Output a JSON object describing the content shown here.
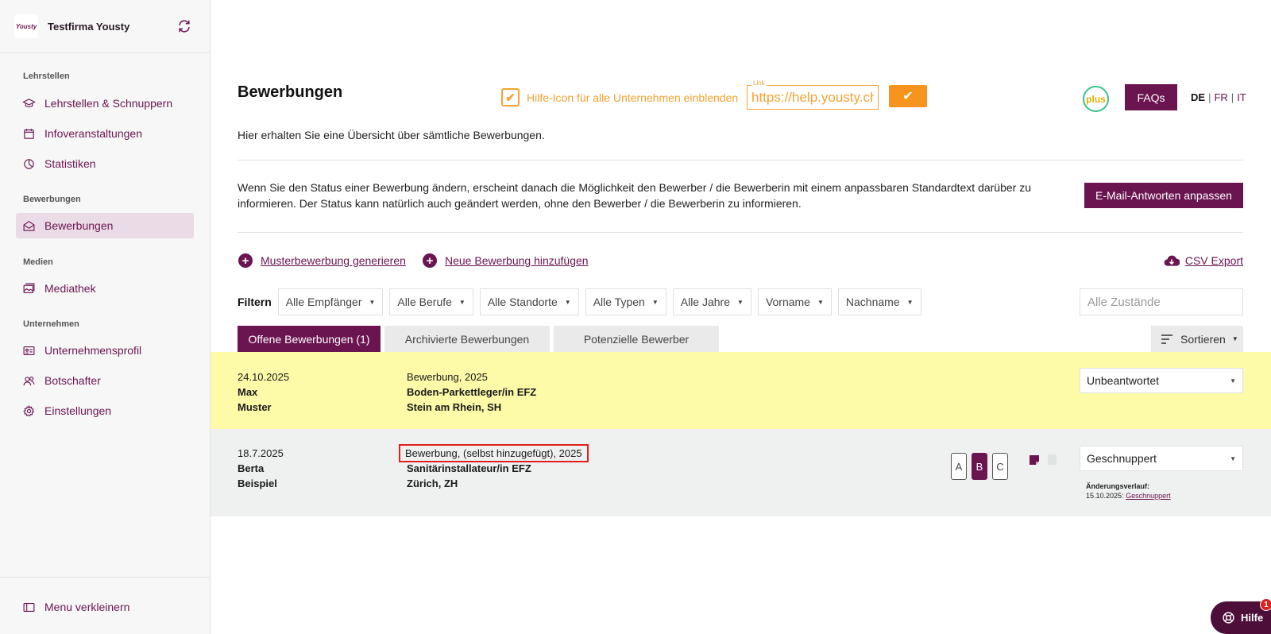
{
  "sidebar": {
    "company": "Testfirma Yousty",
    "logo_text": "Yousty",
    "sections": [
      {
        "label": "Lehrstellen",
        "items": [
          {
            "label": "Lehrstellen & Schnuppern",
            "icon": "graduation-cap-icon"
          },
          {
            "label": "Infoveranstaltungen",
            "icon": "calendar-icon"
          },
          {
            "label": "Statistiken",
            "icon": "pie-chart-icon"
          }
        ]
      },
      {
        "label": "Bewerbungen",
        "items": [
          {
            "label": "Bewerbungen",
            "icon": "envelope-icon",
            "active": true
          }
        ]
      },
      {
        "label": "Medien",
        "items": [
          {
            "label": "Mediathek",
            "icon": "images-icon"
          }
        ]
      },
      {
        "label": "Unternehmen",
        "items": [
          {
            "label": "Unternehmensprofil",
            "icon": "profile-card-icon"
          },
          {
            "label": "Botschafter",
            "icon": "users-icon"
          },
          {
            "label": "Einstellungen",
            "icon": "gear-icon"
          }
        ]
      }
    ],
    "collapse_label": "Menu verkleinern"
  },
  "header": {
    "title": "Bewerbungen",
    "help_toggle_label": "Hilfe-Icon für alle Unternehmen einblenden",
    "link_legend": "Link",
    "link_value": "https://help.yousty.ch",
    "confirm_label": "✔",
    "plus_label": "plus",
    "faq_label": "FAQs",
    "languages": [
      "DE",
      "FR",
      "IT"
    ],
    "current_language": "DE"
  },
  "intro": "Hier erhalten Sie eine Übersicht über sämtliche Bewerbungen.",
  "info": {
    "text": "Wenn Sie den Status einer Bewerbung ändern, erscheint danach die Möglichkeit den Bewerber / die Bewerberin mit einem anpassbaren Standardtext darüber zu informieren. Der Status kann natürlich auch geändert werden, ohne den Bewerber / die Bewerberin zu informieren.",
    "email_button": "E-Mail-Antworten anpassen"
  },
  "actions": {
    "generate": "Musterbewerbung generieren",
    "add": "Neue Bewerbung hinzufügen",
    "csv": "CSV Export"
  },
  "filters": {
    "label": "Filtern",
    "dropdowns": [
      "Alle Empfänger",
      "Alle Berufe",
      "Alle Standorte",
      "Alle Typen",
      "Alle Jahre",
      "Vorname",
      "Nachname"
    ],
    "states_placeholder": "Alle Zustände"
  },
  "tabs": [
    "Offene Bewerbungen (1)",
    "Archivierte Bewerbungen",
    "Potenzielle Bewerber"
  ],
  "sort_label": "Sortieren",
  "applications": [
    {
      "date": "24.10.2025",
      "first_name": "Max",
      "last_name": "Muster",
      "type": "Bewerbung, 2025",
      "profession": "Boden-Parkettleger/in EFZ",
      "location": "Stein am Rhein, SH",
      "status": "Unbeantwortet"
    },
    {
      "date": "18.7.2025",
      "first_name": "Berta",
      "last_name": "Beispiel",
      "type": "Bewerbung, (selbst hinzugefügt), 2025",
      "profession": "Sanitärinstallateur/in EFZ",
      "location": "Zürich, ZH",
      "status": "Geschnuppert",
      "ratings": [
        "A",
        "B",
        "C"
      ],
      "selected_rating": "B",
      "history_label": "Änderungsverlauf:",
      "history_date": "15.10.2025:",
      "history_status": "Geschnuppert"
    }
  ],
  "help_fab": {
    "label": "Hilfe",
    "badge": "1"
  },
  "colors": {
    "brand": "#6a1450",
    "orange": "#f7a232",
    "highlight_row": "#fdfaa8",
    "marker": "#e0201c"
  }
}
